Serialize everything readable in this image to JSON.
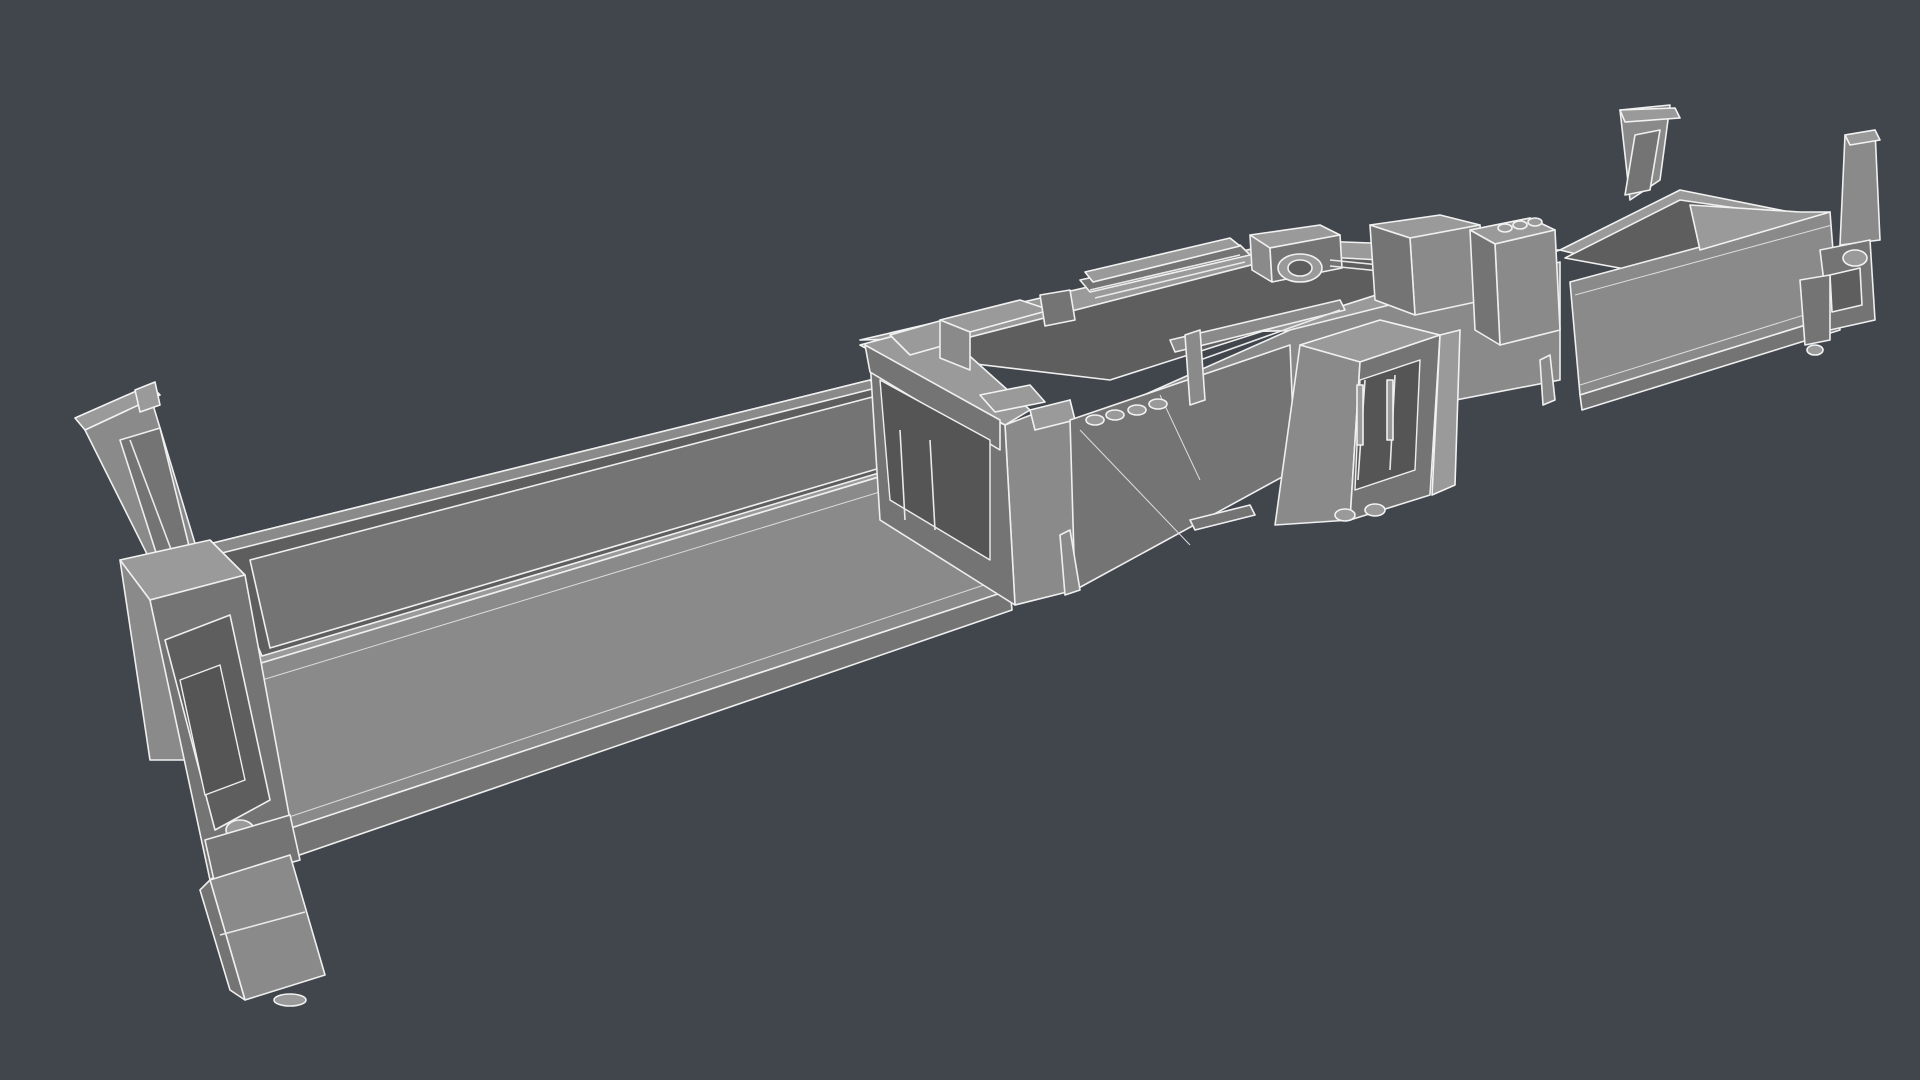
{
  "scene": {
    "subject": "spreader-model-wireframe",
    "background_color": "#41464d",
    "model_color": "#7a7a7a",
    "wire_color": "#eeeeee"
  }
}
